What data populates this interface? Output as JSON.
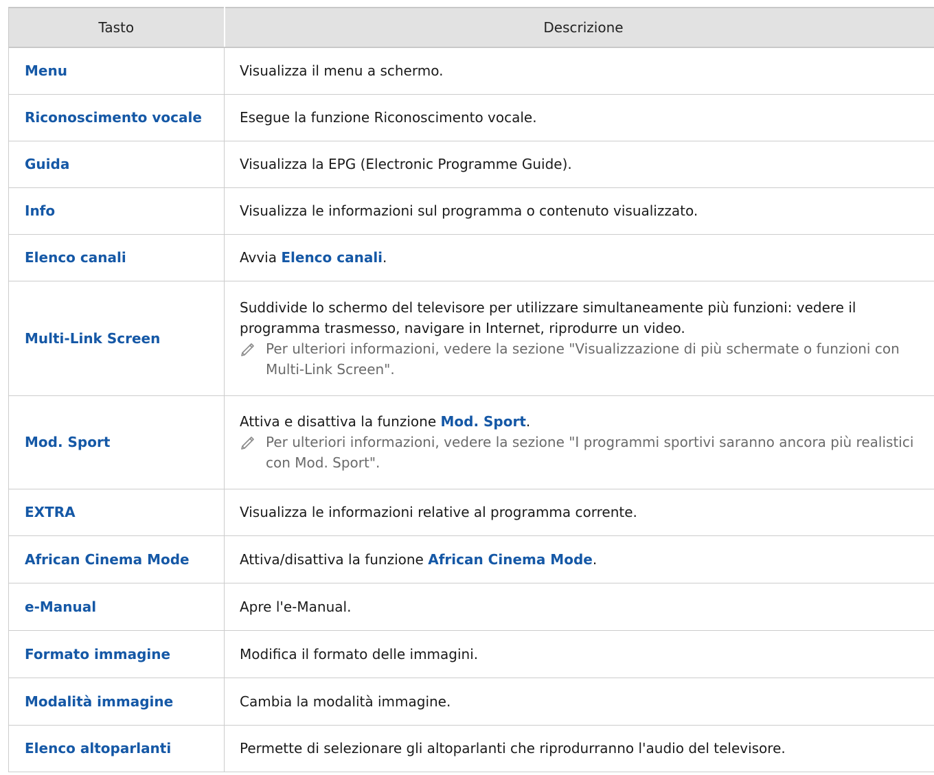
{
  "table": {
    "headers": {
      "key": "Tasto",
      "description": "Descrizione"
    },
    "rows": [
      {
        "key": "Menu",
        "description": "Visualizza il menu a schermo."
      },
      {
        "key": "Riconoscimento vocale",
        "description": "Esegue la funzione Riconoscimento vocale."
      },
      {
        "key": "Guida",
        "description": "Visualizza la EPG (Electronic Programme Guide)."
      },
      {
        "key": "Info",
        "description": "Visualizza le informazioni sul programma o contenuto visualizzato."
      },
      {
        "key": "Elenco canali",
        "description_pre": "Avvia ",
        "description_highlight": "Elenco canali",
        "description_post": "."
      },
      {
        "key": "Multi-Link Screen",
        "description": "Suddivide lo schermo del televisore per utilizzare simultaneamente più funzioni: vedere il programma trasmesso, navigare in Internet, riprodurre un video.",
        "note": "Per ulteriori informazioni, vedere la sezione \"Visualizzazione di più schermate o funzioni con Multi-Link Screen\"."
      },
      {
        "key": "Mod. Sport",
        "description_pre": "Attiva e disattiva la funzione ",
        "description_highlight": "Mod. Sport",
        "description_post": ".",
        "note": "Per ulteriori informazioni, vedere la sezione \"I programmi sportivi saranno ancora più realistici con Mod. Sport\"."
      },
      {
        "key": "EXTRA",
        "description": "Visualizza le informazioni relative al programma corrente."
      },
      {
        "key": "African Cinema Mode",
        "description_pre": "Attiva/disattiva la funzione ",
        "description_highlight": "African Cinema Mode",
        "description_post": "."
      },
      {
        "key": "e-Manual",
        "description": "Apre l'e-Manual."
      },
      {
        "key": "Formato immagine",
        "description": "Modifica il formato delle immagini."
      },
      {
        "key": "Modalità immagine",
        "description": "Cambia la modalità immagine."
      },
      {
        "key": "Elenco altoparlanti",
        "description": "Permette di selezionare gli altoparlanti che riprodurranno l'audio del televisore."
      }
    ]
  },
  "colors": {
    "key_text": "#1558a6",
    "header_bg": "#e2e2e2",
    "note_text": "#6a6a6a",
    "border": "#cccccc"
  },
  "icons": {
    "note": "pencil-icon"
  }
}
